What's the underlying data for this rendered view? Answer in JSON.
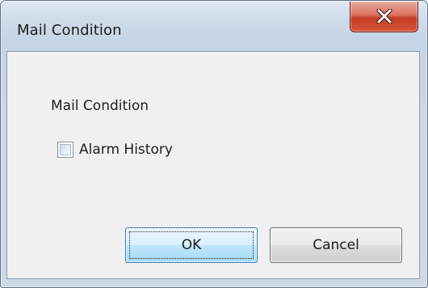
{
  "window": {
    "title": "Mail Condition"
  },
  "group": {
    "label": "Mail Condition"
  },
  "options": [
    {
      "label": "Alarm History",
      "checked": false
    }
  ],
  "buttons": {
    "ok_label": "OK",
    "cancel_label": "Cancel"
  },
  "icons": {
    "close": "close-icon"
  },
  "colors": {
    "close_button": "#c43c22",
    "default_button_border": "#3c7fb1",
    "client_background": "#f0f0f0"
  }
}
